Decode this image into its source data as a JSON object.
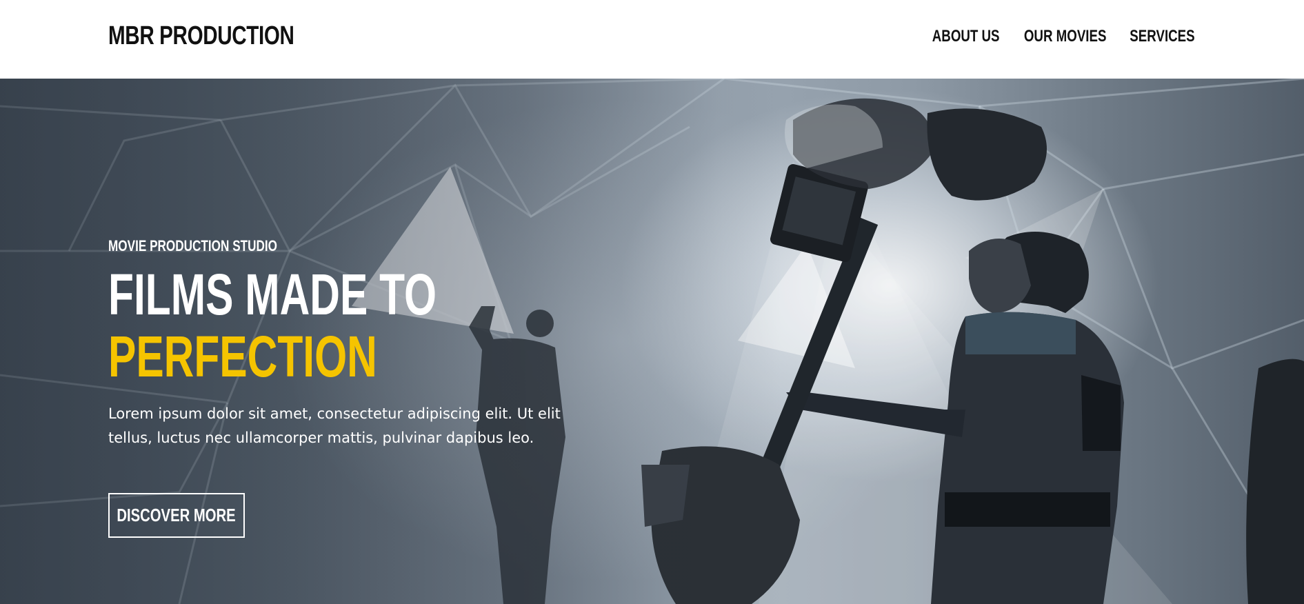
{
  "header": {
    "brand": "MBR PRODUCTION",
    "nav": [
      {
        "label": "ABOUT US"
      },
      {
        "label": "OUR MOVIES"
      },
      {
        "label": "SERVICES"
      }
    ]
  },
  "hero": {
    "eyebrow": "MOVIE PRODUCTION STUDIO",
    "headline_line1": "FILMS MADE TO",
    "headline_accent": "PERFECTION",
    "lead": "Lorem ipsum dolor sit amet, consectetur adipiscing elit. Ut elit tellus, luctus nec ullamcorper mattis, pulvinar dapibus leo.",
    "cta_label": "DISCOVER MORE",
    "image_subject": "cameraman-with-stabilizer-in-dome-studio-photo"
  },
  "colors": {
    "accent": "#f5c400",
    "text_dark": "#111111",
    "hero_text": "#ffffff"
  }
}
